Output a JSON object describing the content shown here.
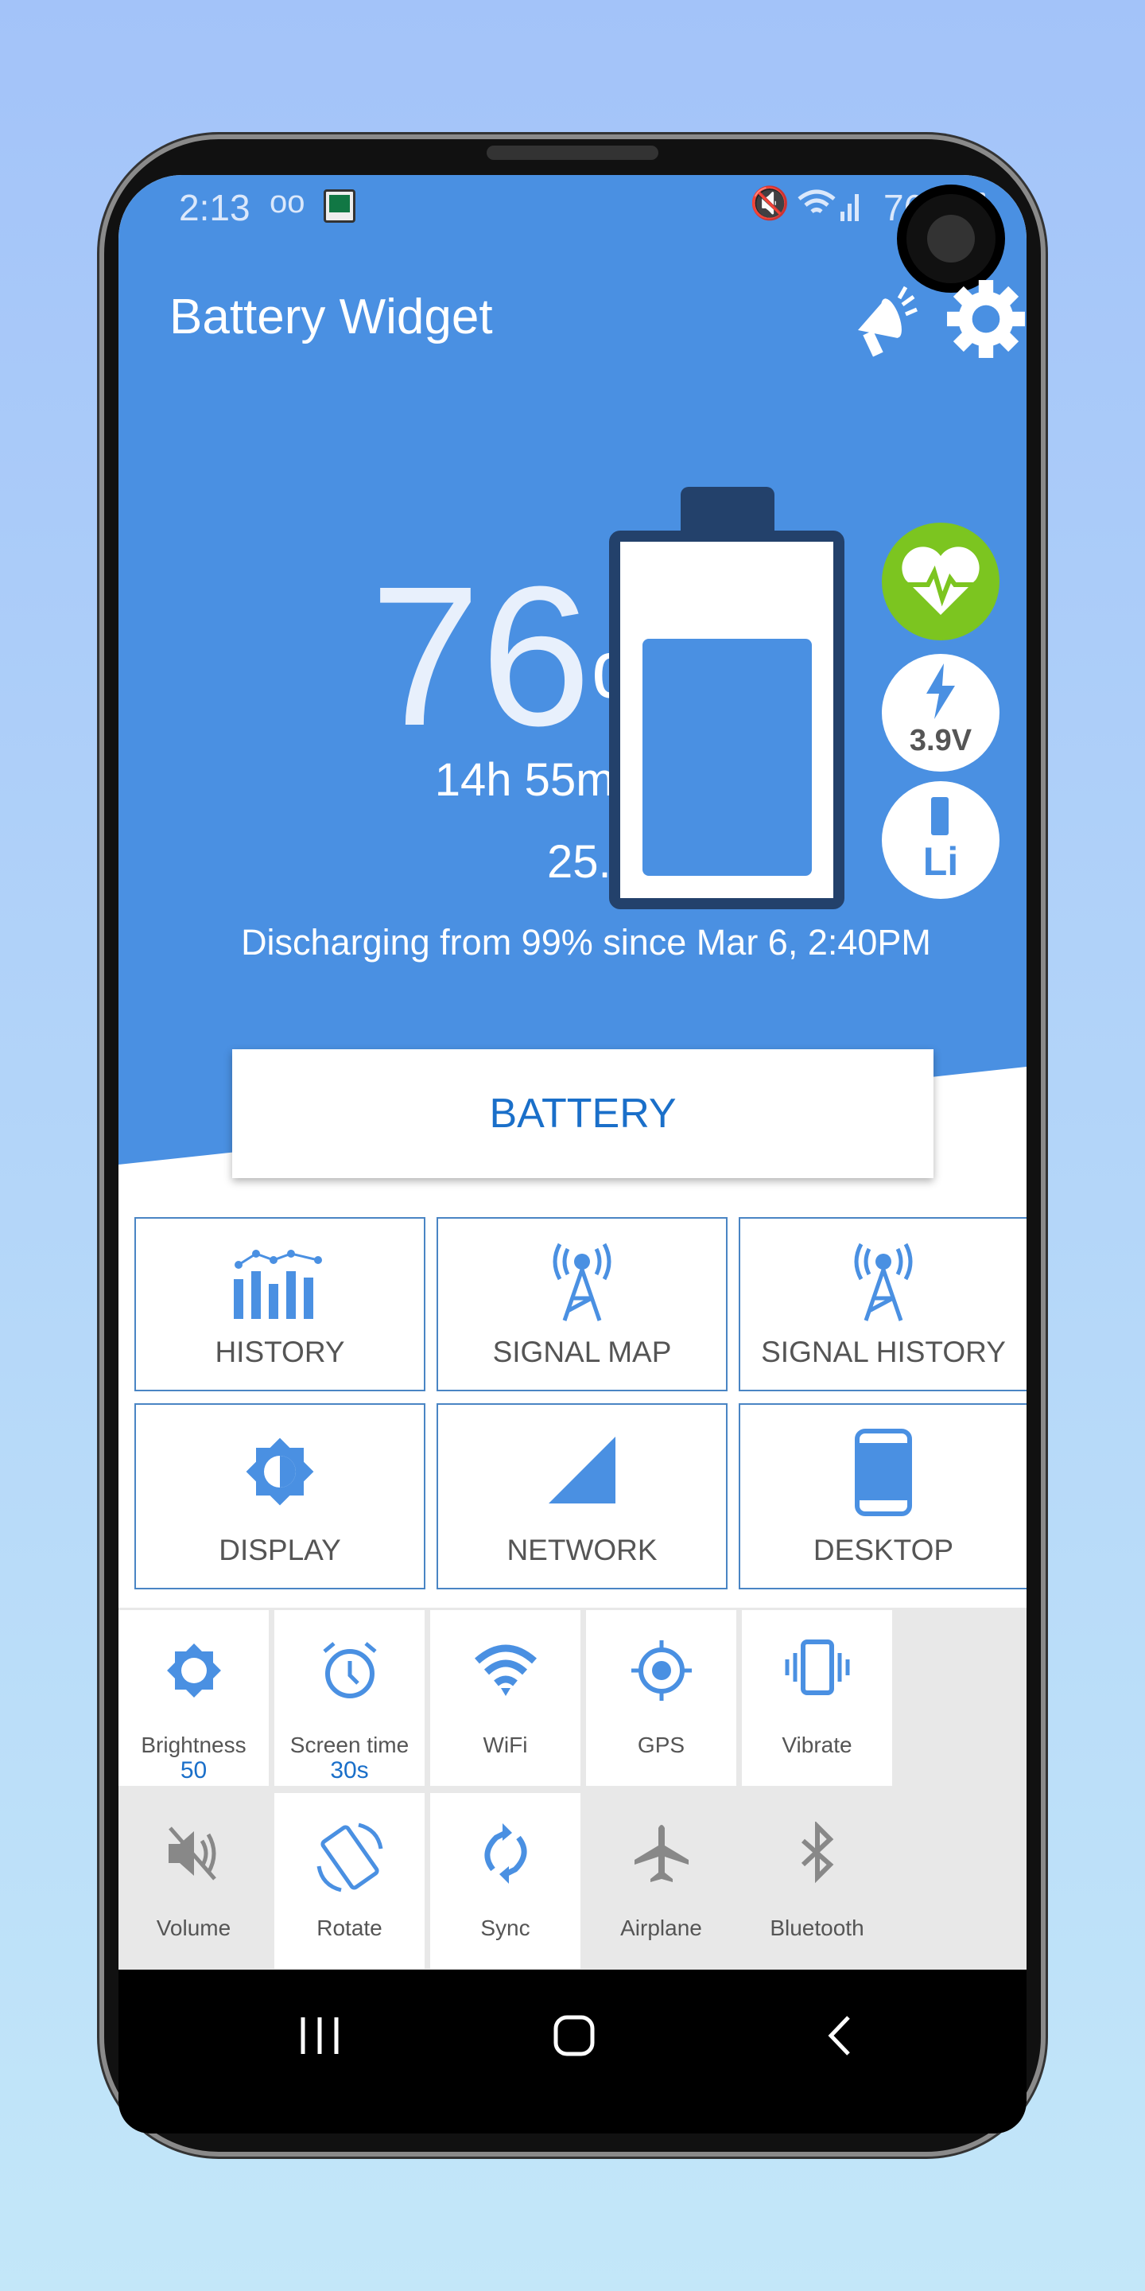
{
  "status_bar": {
    "time": "2:13",
    "battery_percent": "76%"
  },
  "header": {
    "title": "Battery Widget"
  },
  "battery": {
    "percent": "76",
    "percent_sign": "%",
    "level": 0.76,
    "time_left": "14h 55m left",
    "temperature": "25.7°C",
    "status": "Discharging from 99% since Mar 6, 2:40PM",
    "voltage": "3.9V",
    "chemistry": "Li",
    "health_color": "#7cc520"
  },
  "main_button": {
    "label": "BATTERY"
  },
  "grid": [
    {
      "label": "HISTORY",
      "icon": "bar-chart-icon"
    },
    {
      "label": "SIGNAL MAP",
      "icon": "antenna-icon"
    },
    {
      "label": "SIGNAL HISTORY",
      "icon": "antenna-icon"
    },
    {
      "label": "DISPLAY",
      "icon": "brightness-icon"
    },
    {
      "label": "NETWORK",
      "icon": "cell-signal-icon"
    },
    {
      "label": "DESKTOP",
      "icon": "phone-icon"
    }
  ],
  "quick_settings": [
    {
      "label": "Brightness",
      "value": "50",
      "active": true
    },
    {
      "label": "Screen time",
      "value": "30s",
      "active": true
    },
    {
      "label": "WiFi",
      "active": true
    },
    {
      "label": "GPS",
      "active": true
    },
    {
      "label": "Vibrate",
      "active": true
    },
    {
      "label": "Volume",
      "active": false
    },
    {
      "label": "Rotate",
      "active": true
    },
    {
      "label": "Sync",
      "active": true
    },
    {
      "label": "Airplane",
      "active": false
    },
    {
      "label": "Bluetooth",
      "active": false
    }
  ],
  "colors": {
    "primary": "#4a90e2",
    "accent_text": "#1a6fc9",
    "inactive_icon": "#888888"
  }
}
